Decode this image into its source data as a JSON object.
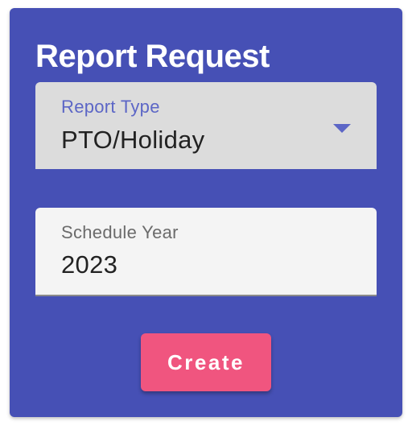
{
  "dialog": {
    "title": "Report Request"
  },
  "report_type": {
    "label": "Report Type",
    "value": "PTO/Holiday"
  },
  "schedule_year": {
    "label": "Schedule Year",
    "value": "2023"
  },
  "actions": {
    "create_label": "Create"
  },
  "icons": {
    "dropdown": "dropdown-arrow-icon"
  },
  "colors": {
    "card_background": "#4650b5",
    "accent": "#5c66c6",
    "create_button": "#f0557f",
    "select_background": "#dcdcdc",
    "input_background": "#f4f4f4"
  }
}
